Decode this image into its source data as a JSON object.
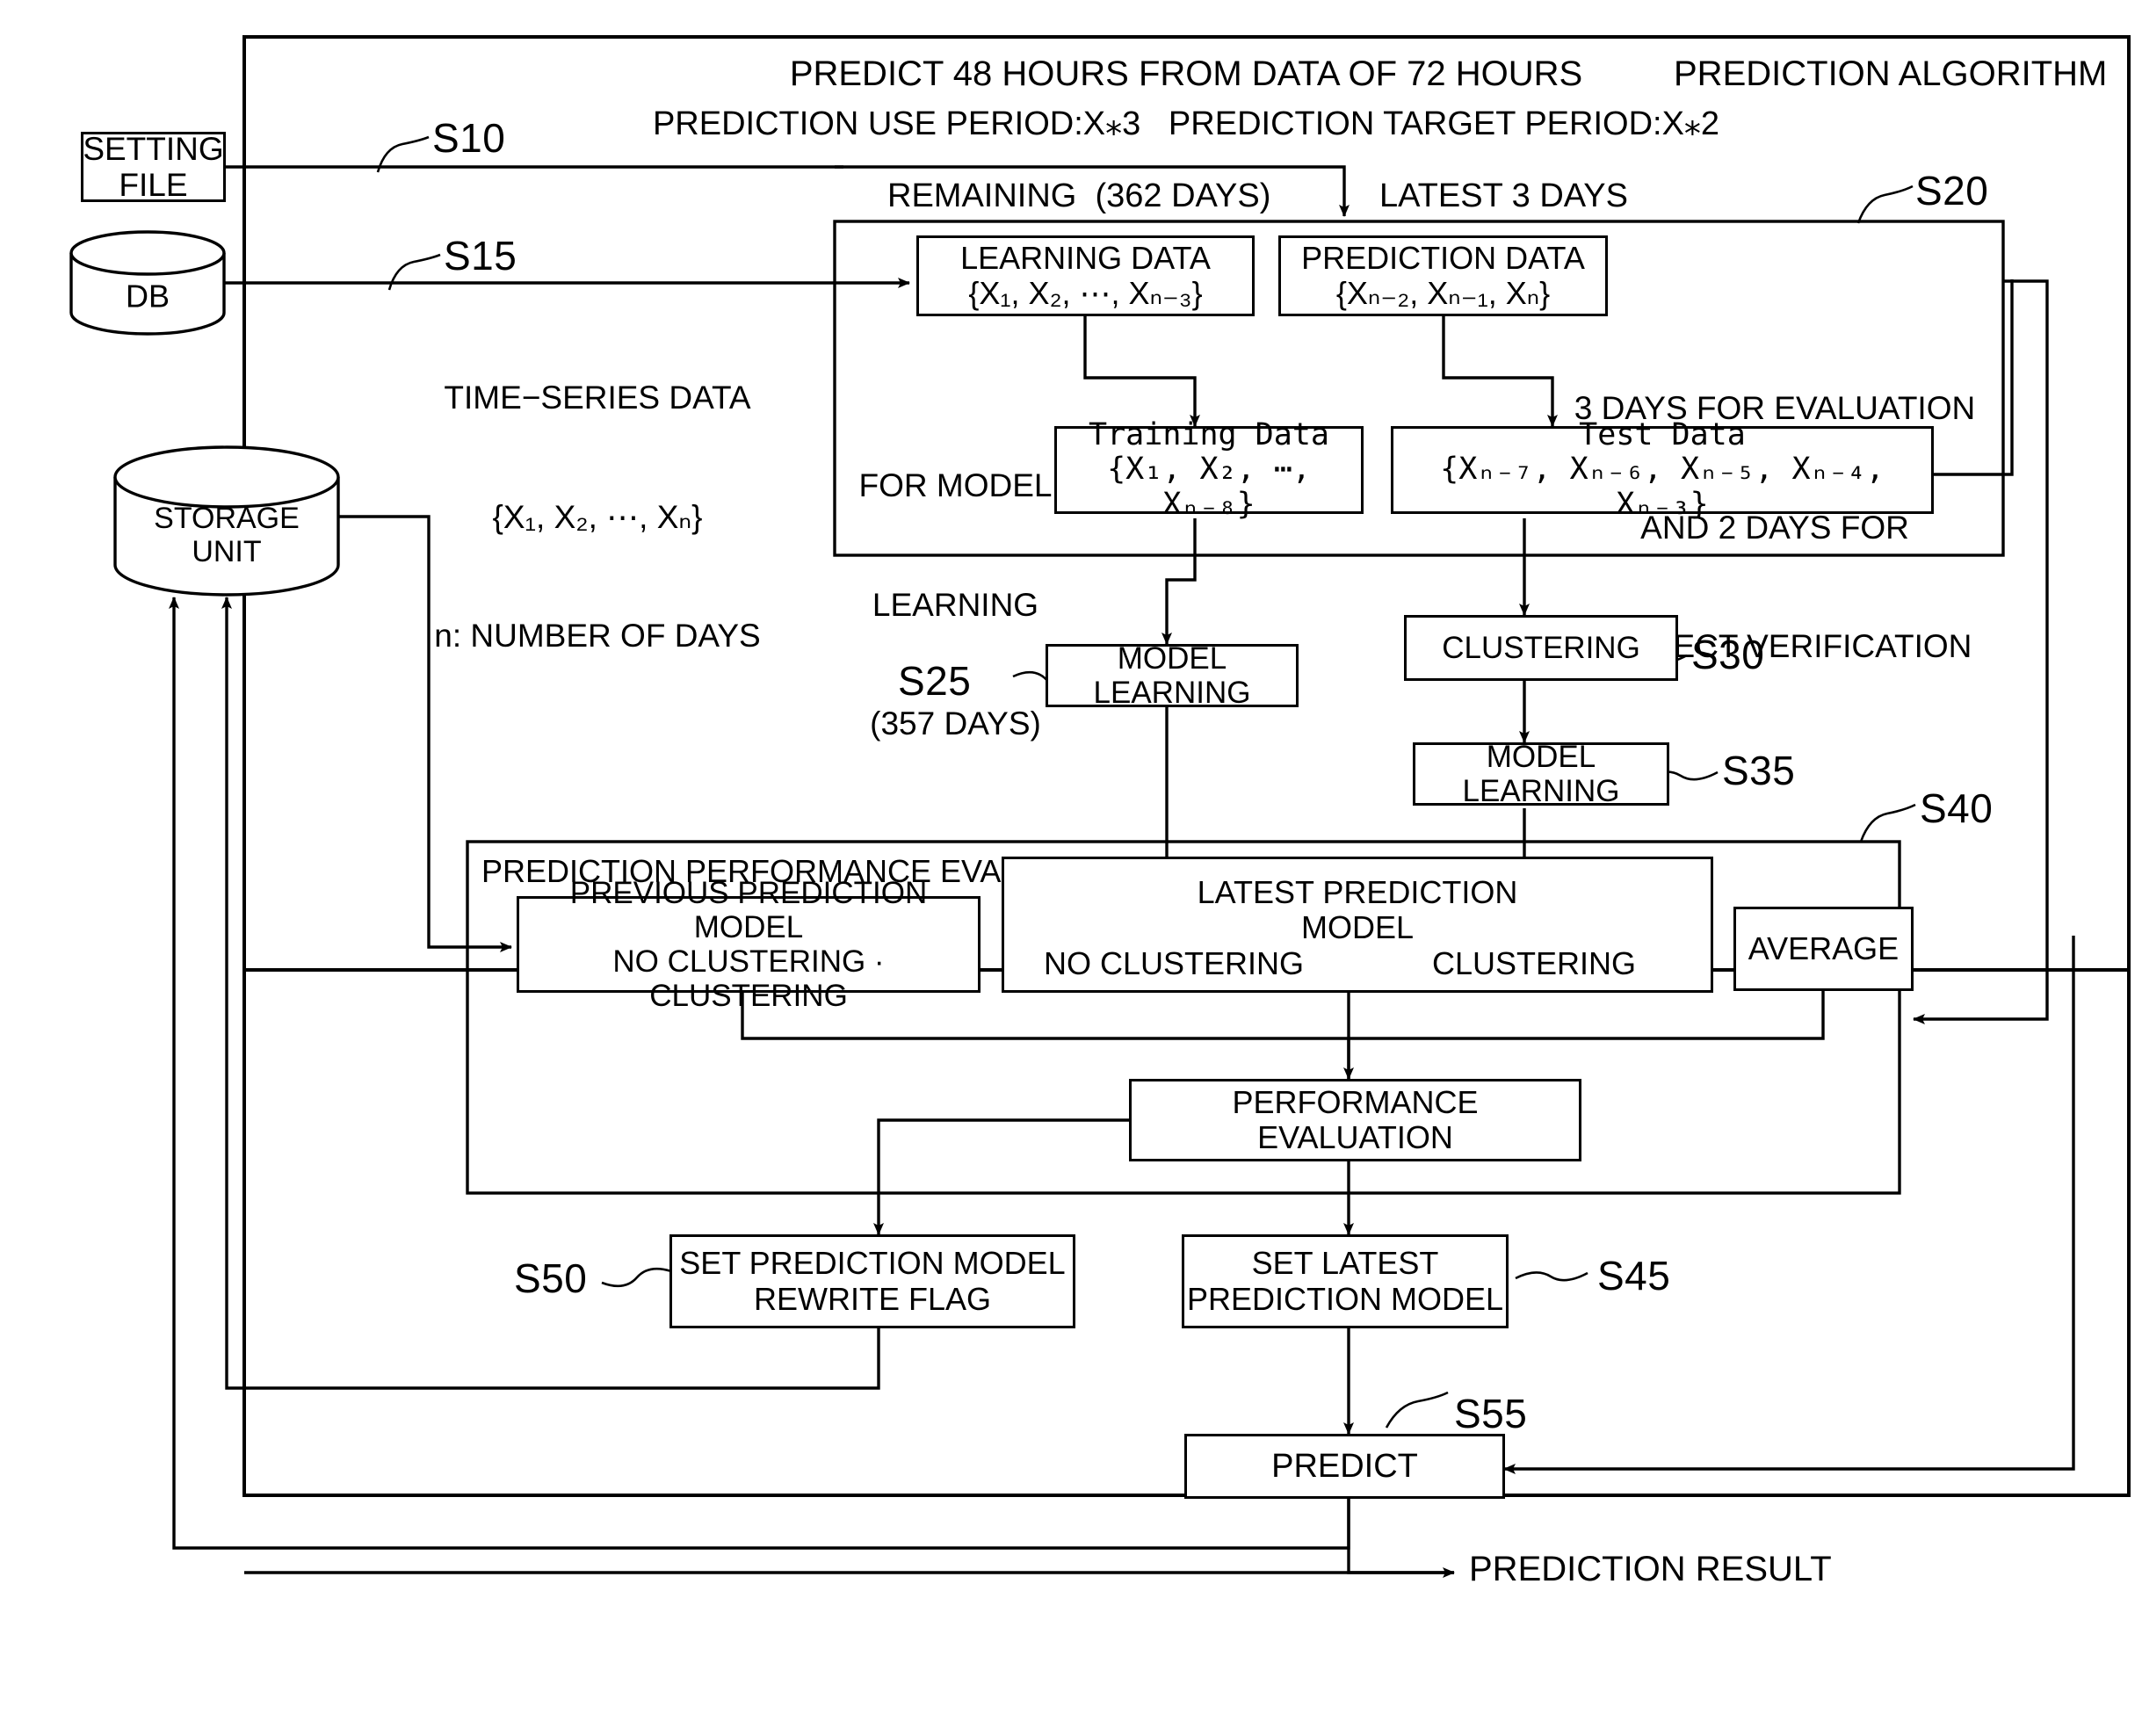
{
  "diagram": {
    "title": "PREDICTION ALGORITHM",
    "header_line1": "PREDICT 48 HOURS FROM DATA OF 72 HOURS",
    "header_line2": "PREDICTION USE PERIOD:X⁎3   PREDICTION TARGET PERIOD:X⁎2"
  },
  "sources": {
    "setting_file": "SETTING FILE",
    "db": "DB",
    "storage_unit_line1": "STORAGE",
    "storage_unit_line2": "UNIT"
  },
  "annotations": {
    "time_series_l1": "TIME−SERIES DATA",
    "time_series_l2": "{X₁, X₂, ⋯, Xₙ}",
    "time_series_l3": "n: NUMBER OF DAYS",
    "remaining": "REMAINING  (362 DAYS)",
    "latest3days": "LATEST 3 DAYS",
    "eval_l1": "3 DAYS FOR EVALUATION",
    "eval_l2": "AND 2 DAYS FOR",
    "eval_l3": "CORRECT VERIFICATION",
    "for_model_l1": "FOR MODEL",
    "for_model_l2": "LEARNING",
    "for_model_l3": "(357 DAYS)",
    "perf_eval_group": "PREDICTION PERFORMANCE EVALUATION",
    "prediction_result": "PREDICTION RESULT"
  },
  "boxes": {
    "learning_data_l1": "LEARNING DATA",
    "learning_data_l2": "{X₁, X₂, ⋯, Xₙ₋₃}",
    "prediction_data_l1": "PREDICTION DATA",
    "prediction_data_l2": "{Xₙ₋₂, Xₙ₋₁, Xₙ}",
    "training_data_l1": "Training Data",
    "training_data_l2": "{X₁, X₂, ⋯,  Xₙ₋₈}",
    "test_data_l1": "Test Data",
    "test_data_l2": "{Xₙ₋₇, Xₙ₋₆, Xₙ₋₅, Xₙ₋₄, Xₙ₋₃}",
    "model_learning_left": "MODEL LEARNING",
    "clustering": "CLUSTERING",
    "model_learning_right": "MODEL LEARNING",
    "previous_model_l1": "PREVIOUS PREDICTION MODEL",
    "previous_model_l2": "NO CLUSTERING · CLUSTERING",
    "latest_model_title_l1": "LATEST PREDICTION",
    "latest_model_title_l2": "MODEL",
    "latest_model_no_clustering": "NO CLUSTERING",
    "latest_model_clustering": "CLUSTERING",
    "average": "AVERAGE",
    "performance_evaluation": "PERFORMANCE EVALUATION",
    "set_rewrite_flag_l1": "SET PREDICTION MODEL",
    "set_rewrite_flag_l2": "REWRITE FLAG",
    "set_latest_model_l1": "SET LATEST",
    "set_latest_model_l2": "PREDICTION MODEL",
    "predict": "PREDICT"
  },
  "steps": {
    "s10": "S10",
    "s15": "S15",
    "s20": "S20",
    "s25": "S25",
    "s30": "S30",
    "s35": "S35",
    "s40": "S40",
    "s45": "S45",
    "s50": "S50",
    "s55": "S55"
  }
}
